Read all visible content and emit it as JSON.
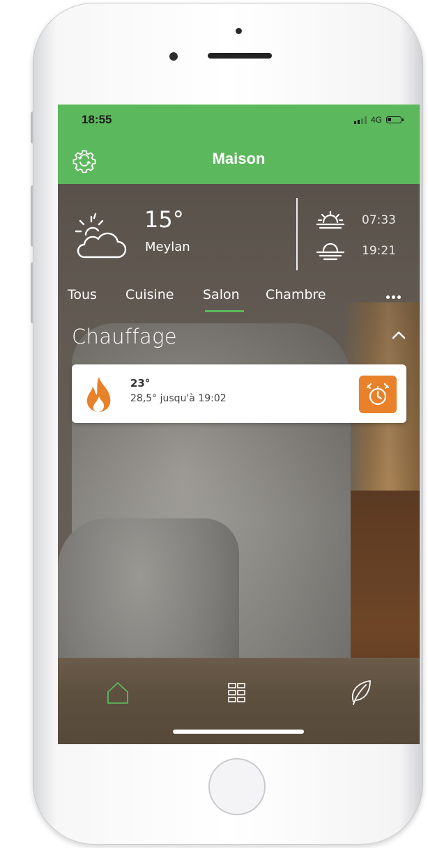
{
  "status_bar": {
    "time": "18:55",
    "network": "4G"
  },
  "header": {
    "title": "Maison",
    "settings_icon": "gear-icon"
  },
  "weather": {
    "temperature": "15°",
    "city": "Meylan",
    "sunrise": "07:33",
    "sunset": "19:21",
    "condition_icon": "partly-cloudy-icon"
  },
  "rooms": {
    "tabs": [
      {
        "label": "Tous"
      },
      {
        "label": "Cuisine"
      },
      {
        "label": "Salon",
        "active": true
      },
      {
        "label": "Chambre"
      }
    ],
    "more_icon": "more-horizontal-icon"
  },
  "section": {
    "title": "Chauffage",
    "collapse_icon": "chevron-up-icon"
  },
  "heating_card": {
    "current_temp": "23°",
    "setpoint_text": "28,5° jusqu'à 19:02",
    "icon": "flame-icon",
    "action_icon": "timer-icon"
  },
  "bottom_nav": {
    "items": [
      {
        "icon": "home-icon",
        "active": true
      },
      {
        "icon": "grid-icon",
        "active": false
      },
      {
        "icon": "leaf-icon",
        "active": false
      }
    ]
  },
  "colors": {
    "accent_green": "#5cb85c",
    "heating_orange": "#e8812a",
    "card_background": "#ffffff",
    "tab_bar": "#5e503f"
  }
}
